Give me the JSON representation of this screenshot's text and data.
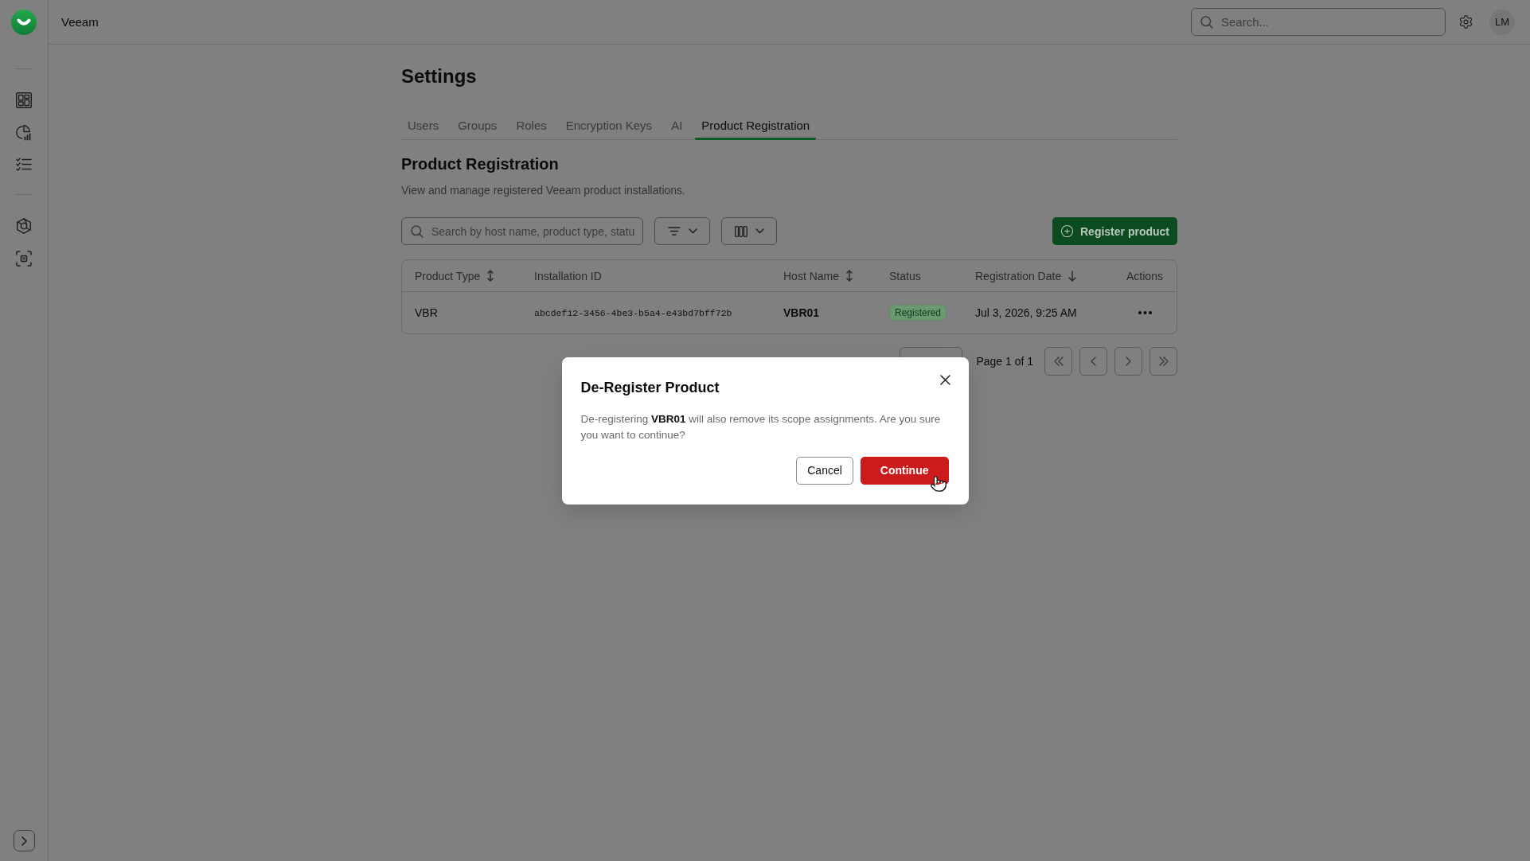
{
  "top_bar": {
    "title": "Veeam",
    "search": {
      "placeholder": "Search..."
    },
    "avatar": {
      "initials": "LM"
    }
  },
  "page": {
    "title": "Settings"
  },
  "tabs": [
    {
      "label": "Users",
      "selected": false
    },
    {
      "label": "Groups",
      "selected": false
    },
    {
      "label": "Roles",
      "selected": false
    },
    {
      "label": "Encryption Keys",
      "selected": false
    },
    {
      "label": "AI",
      "selected": false
    },
    {
      "label": "Product Registration",
      "selected": true
    }
  ],
  "section": {
    "title": "Product Registration",
    "description": "View and manage registered Veeam product installations."
  },
  "toolbar": {
    "search": {
      "placeholder": "Search by host name, product type, statu"
    },
    "register_button": {
      "label": "Register product"
    }
  },
  "table": {
    "columns": [
      {
        "label": "Product Type",
        "kind": "sortable"
      },
      {
        "label": "Installation ID",
        "kind": "plain"
      },
      {
        "label": "Host Name",
        "kind": "sortable"
      },
      {
        "label": "Status",
        "kind": "plain"
      },
      {
        "label": "Registration Date",
        "kind": "sorted"
      },
      {
        "label": "Actions",
        "kind": "plain"
      }
    ],
    "rows": [
      {
        "product_type": "VBR",
        "installation_id": "abcdef12-3456-4be3-b5a4-e43bd7bff72b",
        "host_name": "VBR01",
        "status": "Registered",
        "registration_date": "Jul 3, 2026, 9:25 AM"
      }
    ]
  },
  "pagination": {
    "label": "Page 1 of 1"
  },
  "dialog": {
    "title": "De-Register Product",
    "message": "De-registering **VBR01** will also remove its scope assignments. Are you sure you want to continue?",
    "buttons": [
      {
        "label": "Cancel",
        "kind": "secondary"
      },
      {
        "label": "Continue",
        "kind": "danger"
      }
    ]
  }
}
